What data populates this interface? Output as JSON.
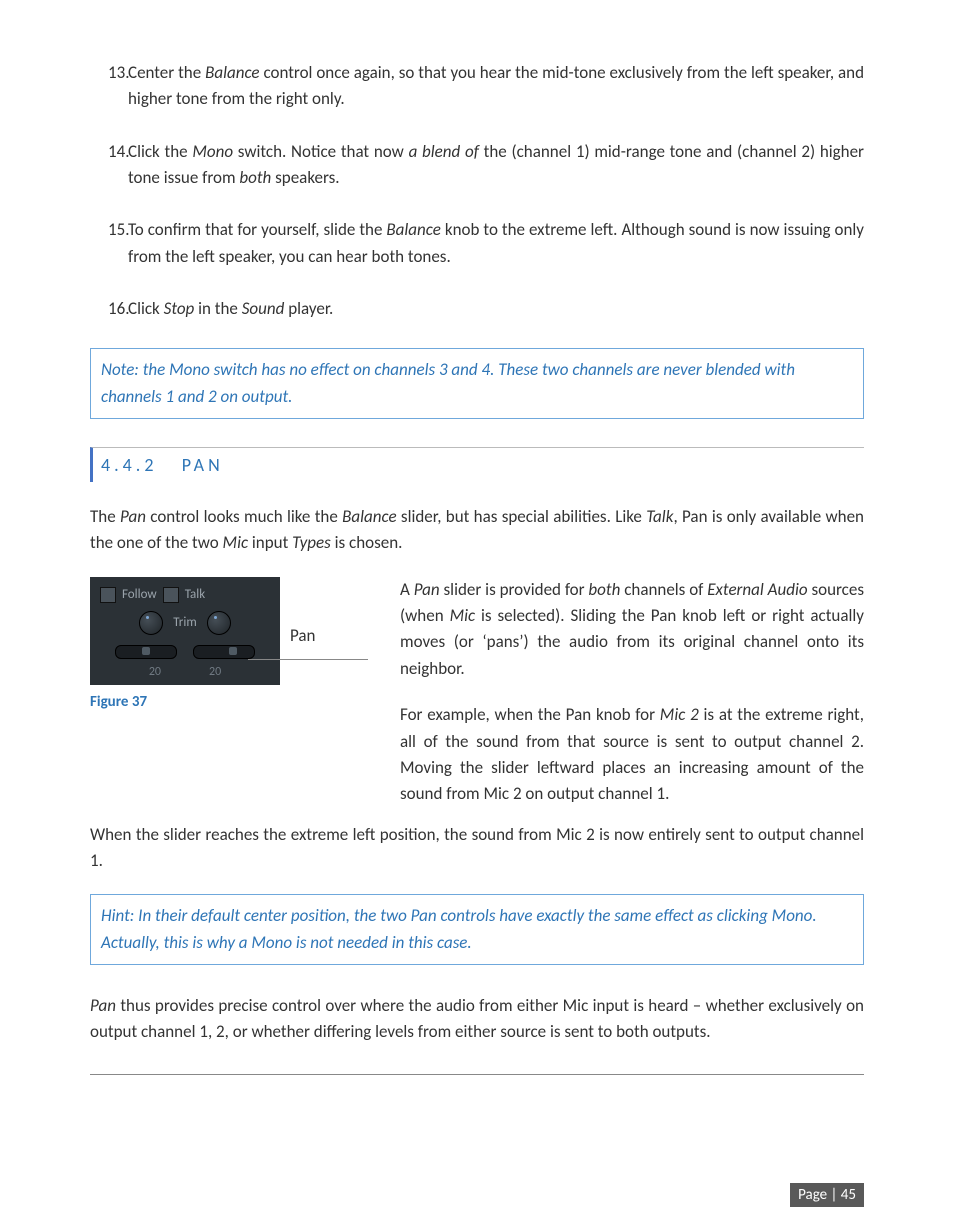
{
  "list": {
    "items": [
      {
        "num": "13.",
        "text": "Center the <i>Balance</i> control once again, so that you hear the mid-tone exclusively from the left speaker, and higher tone from the right only."
      },
      {
        "num": "14.",
        "text": "Click the <i>Mono</i> switch.  Notice that now <i>a blend of</i> the (channel 1) mid-range tone and (channel 2) higher tone issue from <i>both</i> speakers."
      },
      {
        "num": "15.",
        "text": "To confirm that for yourself, slide the <i>Balance</i> knob to the extreme left.  Although sound is now issuing only from the left speaker, you can hear both tones."
      },
      {
        "num": "16.",
        "text": "Click <i>Stop</i> in the <i>Sound</i> player."
      }
    ]
  },
  "note1": "Note: the Mono switch has no effect on channels 3 and 4.  These two channels are never blended with channels 1 and 2 on output.",
  "section": {
    "number": "4.4.2",
    "title": "PAN"
  },
  "intro": "The <i>Pan</i> control looks much like the <i>Balance</i> slider, but has special abilities.  Like <i>Talk</i>, Pan is only available when the one of the two <i>Mic</i> input <i>Types</i> is chosen.",
  "figure": {
    "follow": "Follow",
    "talk": "Talk",
    "trim": "Trim",
    "val_left": "20",
    "val_right": "20",
    "pan_label": "Pan",
    "caption": "Figure 37"
  },
  "right_para1": "A <i>Pan</i> slider is provided for <i>both</i> channels of <i>External Audio</i> sources (when <i>Mic</i> is selected).  Sliding the Pan knob left or right actually moves (or ‘pans’) the audio from its original channel onto its neighbor.",
  "right_para2": "For example, when the Pan knob for <i>Mic 2</i> is at the extreme right, all of the sound from that source is sent to output channel 2.  Moving the slider leftward places an increasing amount of the sound from Mic 2 on output channel 1.",
  "after_fig": "When the slider reaches the extreme left position, the sound from Mic 2 is now entirely sent to output channel 1.",
  "hint": "Hint: In their default center position, the two Pan controls have exactly the same effect as clicking Mono.  Actually, this is why a Mono is not needed in this case.",
  "closing": "<i>Pan</i> thus provides precise control over where the audio from either Mic input is heard – whether exclusively on output channel 1, 2, or whether differing levels from either source is sent to both outputs.",
  "footer": {
    "page_label": "Page | 45"
  }
}
